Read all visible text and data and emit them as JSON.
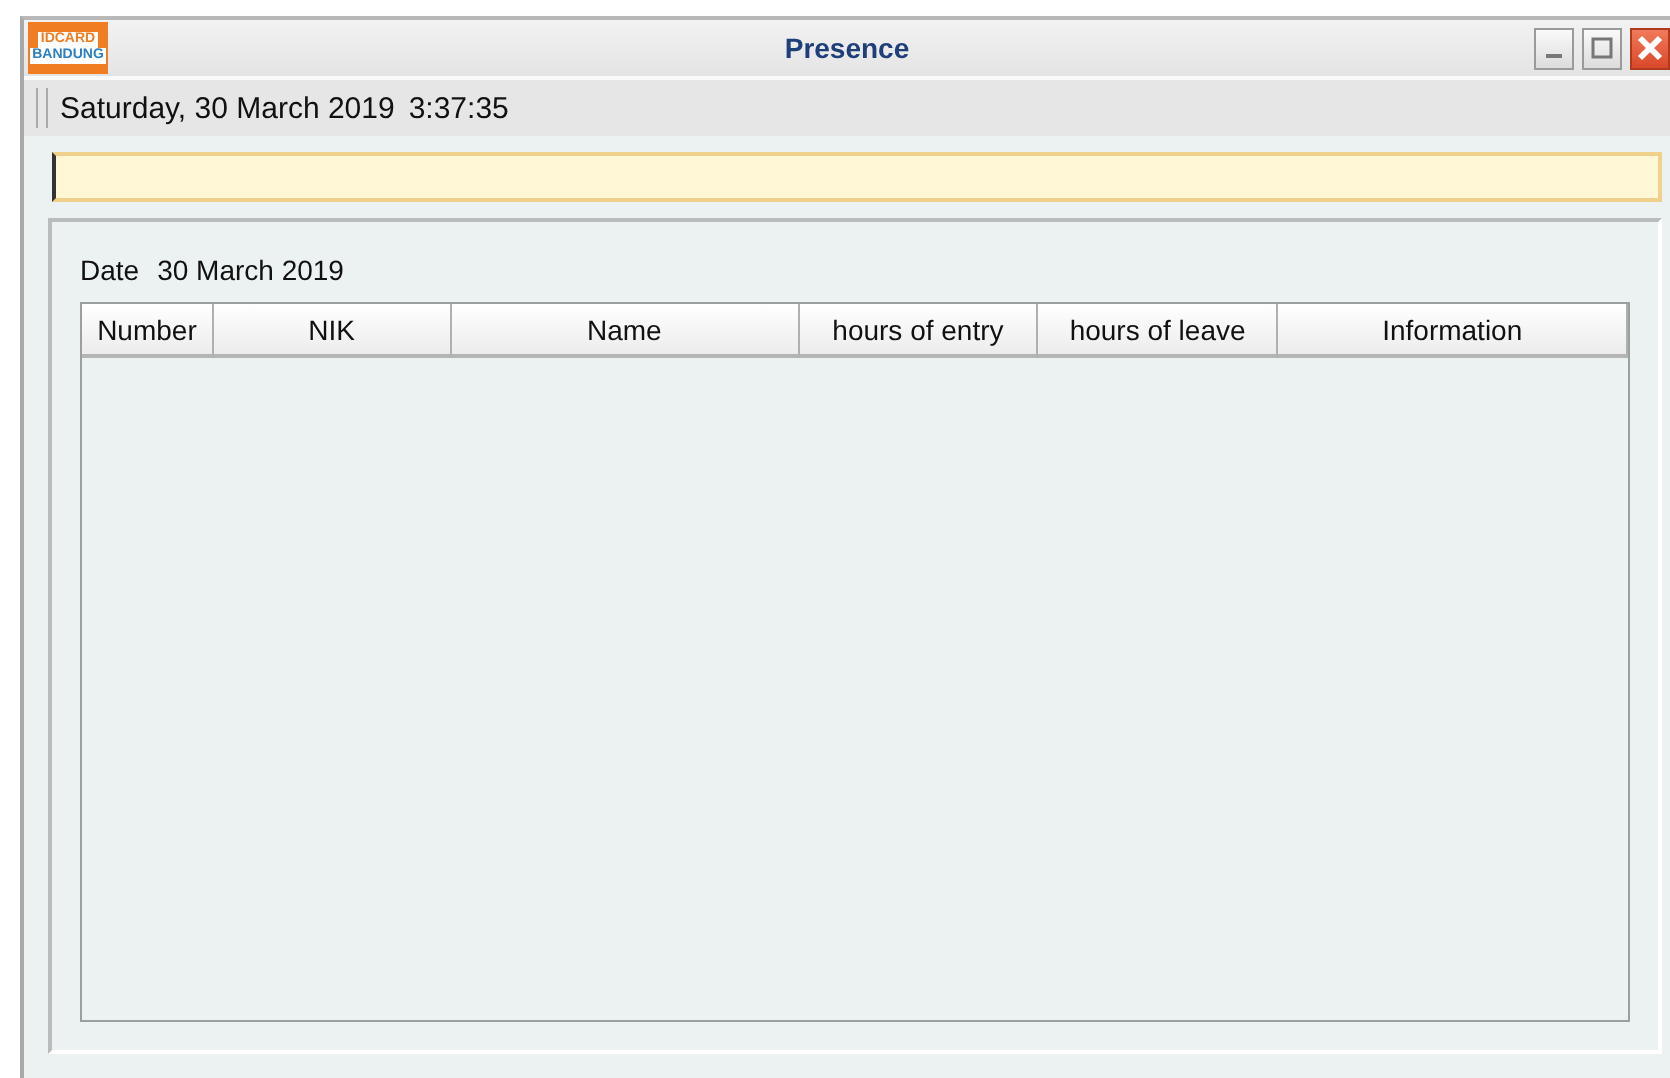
{
  "window": {
    "title": "Presence",
    "logo": [
      "IDCARD",
      "BANDUNG"
    ]
  },
  "toolbar": {
    "datetime": "Saturday, 30 March 2019",
    "time": "3:37:35"
  },
  "panel": {
    "date_label": "Date",
    "date_value": "30 March 2019"
  },
  "table": {
    "columns": [
      {
        "label": "Number"
      },
      {
        "label": "NIK"
      },
      {
        "label": "Name"
      },
      {
        "label": "hours of entry"
      },
      {
        "label": "hours of leave"
      },
      {
        "label": "Information"
      }
    ]
  }
}
